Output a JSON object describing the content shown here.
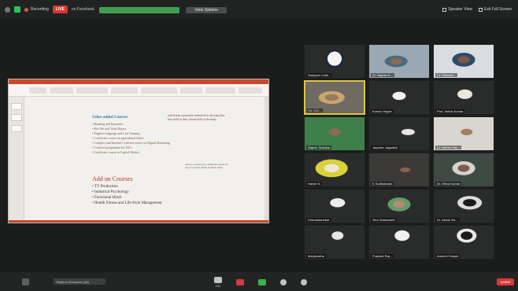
{
  "topbar": {
    "recording_label": "Recording",
    "live_label": "LIVE",
    "on_label": "on Facebook",
    "share_banner": "",
    "view_options": "View Options",
    "speaker_view": "Speaker View",
    "exit_fullscreen": "Exit Full Screen"
  },
  "slide": {
    "value_added_title": "Value-added Courses",
    "value_added_items": [
      "Banking and Insurance",
      "Bee Net and Vesta Basics",
      "English Language and Life Training",
      "Certificate course on agricultural fibres",
      "Complex and Internet Certified course on Digital Marketing",
      "Certified programme for DLC",
      "Certificate course in Capital Market"
    ],
    "note_right": "which help a particular individual in showing their best skills in their chosen field of the study.",
    "note_right_2": "Add on courses is a certificate course on top of courses which students learn",
    "addon_title": "Add on Courses",
    "addon_items": [
      "TV Production",
      "Industrial Psychology",
      "Functional Hindi",
      "Health Fitness and Life Style Management"
    ]
  },
  "participants": [
    {
      "name": "Sahyadri Colle...",
      "tone": "logo"
    },
    {
      "name": "Dr. Rajesh K...",
      "tone": "face1"
    },
    {
      "name": "Dr. Siddesh...",
      "tone": "face2"
    },
    {
      "name": "Dr. S.D...",
      "tone": "face3",
      "active": true
    },
    {
      "name": "Kumar Hegde",
      "tone": "dark"
    },
    {
      "name": "Prof. Ashok Kumar",
      "tone": "face4"
    },
    {
      "name": "Rajesh Shankar",
      "tone": "green"
    },
    {
      "name": "Jayadev Jagadish",
      "tone": "dark"
    },
    {
      "name": "Dr. Nethra Raj...",
      "tone": "face5"
    },
    {
      "name": "Harish N",
      "tone": "yellow"
    },
    {
      "name": "K Sudhakaran",
      "tone": "face6"
    },
    {
      "name": "Dr. Shiva Kumar",
      "tone": "face7"
    },
    {
      "name": "Chandrashekar",
      "tone": "dark"
    },
    {
      "name": "Siva Saraswathi",
      "tone": "face8"
    },
    {
      "name": "Dr. Ashok Ra...",
      "tone": "dark"
    },
    {
      "name": "Manjunatha",
      "tone": "dark2"
    },
    {
      "name": "Prakash Raj...",
      "tone": "face9"
    },
    {
      "name": "Aravind Hospet",
      "tone": "dark2"
    }
  ],
  "bottombar": {
    "chat_placeholder": "Reply to Everyone (All)",
    "participants_count": "101",
    "leave_label": "Leave"
  },
  "colors": {
    "ribbon": "#c6492e",
    "addon_title": "#b2382a",
    "value_title": "#3b6fb0",
    "active_speaker": "#e0c442",
    "leave": "#d93a36"
  }
}
